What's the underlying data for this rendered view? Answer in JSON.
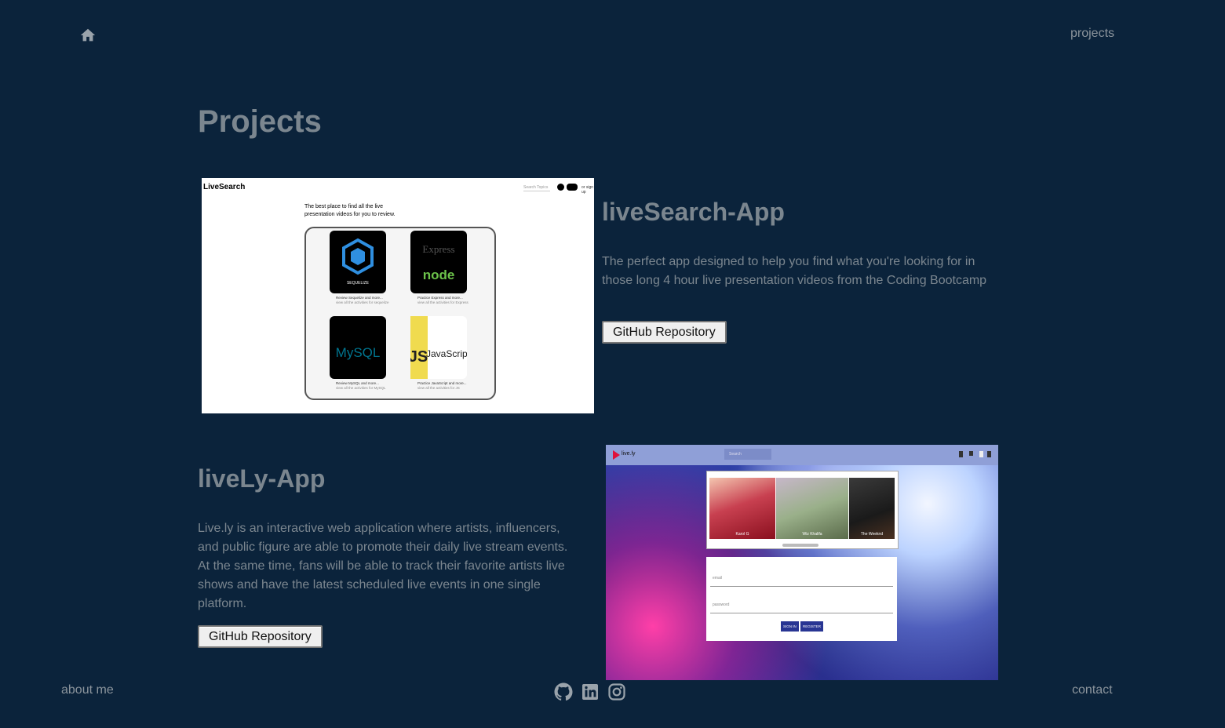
{
  "nav": {
    "home_icon": "home-icon",
    "projects_label": "projects"
  },
  "page": {
    "title": "Projects"
  },
  "projects": [
    {
      "title": "liveSearch-App",
      "description": "The perfect app designed to help you find what you're looking for in those long 4 hour live presentation videos from the Coding Bootcamp",
      "button_label": "GitHub Repository",
      "screenshot": {
        "logo": "LiveSearch",
        "search_placeholder": "Search Topics",
        "login_label": "Log in",
        "signup_label": "or sign up",
        "tagline": "The best place to find all the live presentation videos for you to review.",
        "cards": [
          {
            "name": "SEQUELIZE",
            "caption": "Review Sequelize and more...",
            "sub": "view all the activities for sequelize"
          },
          {
            "name": "Express node",
            "caption": "Practice Express and more...",
            "sub": "view all the activities for Express"
          },
          {
            "name": "MySQL",
            "caption": "Review MySQL and more...",
            "sub": "view all the activities for MySQL"
          },
          {
            "name": "JavaScript",
            "caption": "Practice JavaScript and more...",
            "sub": "view all the activities for JS"
          }
        ]
      }
    },
    {
      "title": "liveLy-App",
      "description": "Live.ly is an interactive web application where artists, influencers, and public figure are able to promote their daily live stream events. At the same time, fans will be able to track their favorite artists live shows and have the latest scheduled live events in one single platform.",
      "button_label": "GitHub Repository",
      "screenshot": {
        "logo": "live.ly",
        "search_placeholder": "Search",
        "artists": [
          "Karol G",
          "Wiz Khalifa",
          "The Weeknd"
        ],
        "email_placeholder": "email",
        "password_placeholder": "password",
        "sign_in_label": "SIGN IN",
        "register_label": "REGISTER"
      }
    }
  ],
  "footer": {
    "about_label": "about me",
    "contact_label": "contact",
    "social_icons": [
      "github-icon",
      "linkedin-icon",
      "instagram-icon"
    ]
  },
  "colors": {
    "background": "#0b233b",
    "text": "#7b868f",
    "button_bg": "#efefef"
  }
}
